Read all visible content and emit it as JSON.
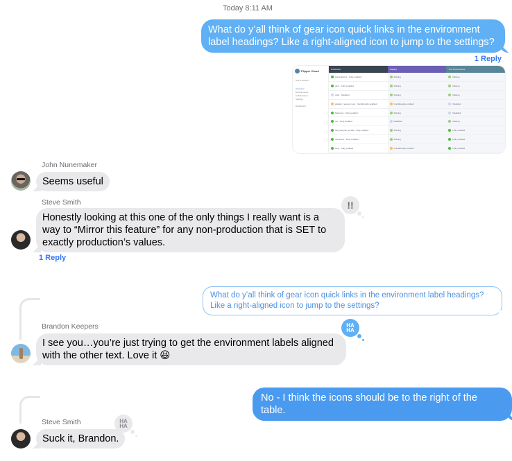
{
  "timestamp": "Today 8:11 AM",
  "colors": {
    "sent_bubble": "#5fb0f5",
    "sent_bubble_2": "#4a9bf0",
    "received_bubble": "#e9e9eb",
    "link": "#3478f6",
    "tapback_haha_active": "#5fb0f5",
    "tapback_inactive": "#e9e9eb"
  },
  "messages": [
    {
      "id": "m1",
      "direction": "sent",
      "text": "What do y’all think of gear icon quick links in the environment label headings? Like a right-aligned icon to jump to the settings?",
      "reply_count_label": "1 Reply"
    },
    {
      "id": "m1-attachment",
      "direction": "sent",
      "type": "image",
      "description": "Flipper Cloud feature table screenshot",
      "embedded": {
        "app_name": "Flipper Cloud",
        "sidebar": [
          "Add a Feature",
          "Overview",
          "Environments",
          "Collaborators",
          "Settings",
          "Dashboard"
        ],
        "columns": [
          "Production",
          "Staging",
          "Your Environment"
        ],
        "column_colors": [
          "#3a4450",
          "#6b5fb5",
          "#5a8598"
        ],
        "rows": [
          {
            "feature": "subscriptions",
            "production": "Fully enabled",
            "staging": "Missing",
            "yours": "Missing"
          },
          {
            "feature": "docs",
            "production": "Fully enabled",
            "staging": "Missing",
            "yours": "Missing"
          },
          {
            "feature": "vsite",
            "production": "Disabled",
            "staging": "Missing",
            "yours": "Missing"
          },
          {
            "feature": "adapter_request_logs",
            "production": "Conditionally enabled",
            "staging": "Conditionally enabled",
            "yours": "Disabled"
          },
          {
            "feature": "balanced",
            "production": "Fully enabled",
            "staging": "Missing",
            "yours": "Disabled"
          },
          {
            "feature": "ots",
            "production": "Fully enabled",
            "staging": "Disabled",
            "yours": "Missing"
          },
          {
            "feature": "trial_lifecycle_emails",
            "production": "Fully enabled",
            "staging": "Missing",
            "yours": "Fully enabled"
          },
          {
            "feature": "document",
            "production": "Fully enabled",
            "staging": "Missing",
            "yours": "Fully enabled"
          },
          {
            "feature": "blog",
            "production": "Fully enabled",
            "staging": "Conditionally enabled",
            "yours": "Fully enabled"
          }
        ]
      }
    },
    {
      "id": "m2",
      "direction": "received",
      "sender": "John Nunemaker",
      "text": "Seems useful"
    },
    {
      "id": "m3",
      "direction": "received",
      "sender": "Steve Smith",
      "text": "Honestly looking at this one of the only things I really want is a way to “Mirror this feature” for any non-production that is SET to exactly production’s values.",
      "tapback": "!!",
      "reply_count_label": "1 Reply"
    },
    {
      "id": "m4-quote",
      "direction": "sent",
      "type": "quoted",
      "text": "What do y’all think of gear icon quick links in the environment label headings? Like a right-aligned icon to jump to the settings?"
    },
    {
      "id": "m5",
      "direction": "received",
      "sender": "Brandon Keepers",
      "text": "I see you…you’re just trying to get the environment labels aligned with the other text. Love it 😆",
      "tapback": "HA HA"
    },
    {
      "id": "m6",
      "direction": "sent",
      "text": "No - I think the icons should be to the right of the table."
    },
    {
      "id": "m7",
      "direction": "received",
      "sender": "Steve Smith",
      "text": "Suck it, Brandon.",
      "tapback": "HA HA"
    }
  ]
}
